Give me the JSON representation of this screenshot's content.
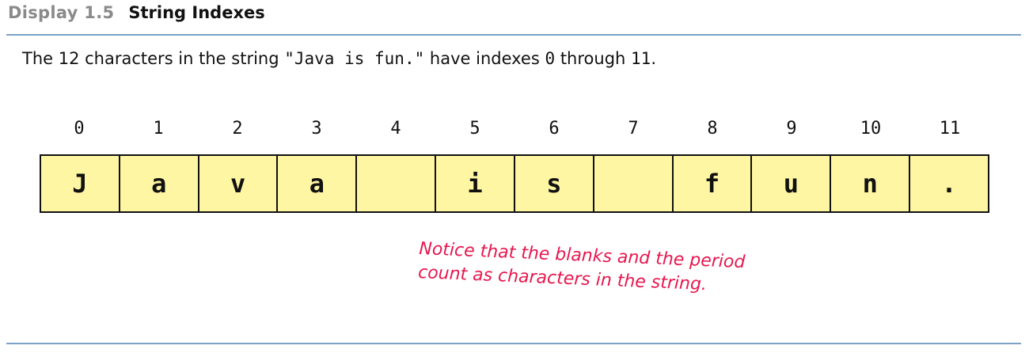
{
  "header": {
    "display_label": "Display 1.5",
    "title": "String Indexes"
  },
  "intro": {
    "before": "The 12 characters in the string ",
    "string_literal": "\"Java is fun.\"",
    "middle": " have indexes ",
    "first_index": "0",
    "through": " through ",
    "last_index": "11",
    "end": "."
  },
  "cells": [
    {
      "index": "0",
      "char": "J"
    },
    {
      "index": "1",
      "char": "a"
    },
    {
      "index": "2",
      "char": "v"
    },
    {
      "index": "3",
      "char": "a"
    },
    {
      "index": "4",
      "char": " "
    },
    {
      "index": "5",
      "char": "i"
    },
    {
      "index": "6",
      "char": "s"
    },
    {
      "index": "7",
      "char": " "
    },
    {
      "index": "8",
      "char": "f"
    },
    {
      "index": "9",
      "char": "u"
    },
    {
      "index": "10",
      "char": "n"
    },
    {
      "index": "11",
      "char": "."
    }
  ],
  "note": {
    "line1": "Notice that the blanks and the period",
    "line2": "count as characters in the string."
  },
  "colors": {
    "cell_fill": "#fff6a3",
    "rule": "#7aa3c6",
    "note": "#e8174e",
    "display_label": "#8a8a8a"
  }
}
